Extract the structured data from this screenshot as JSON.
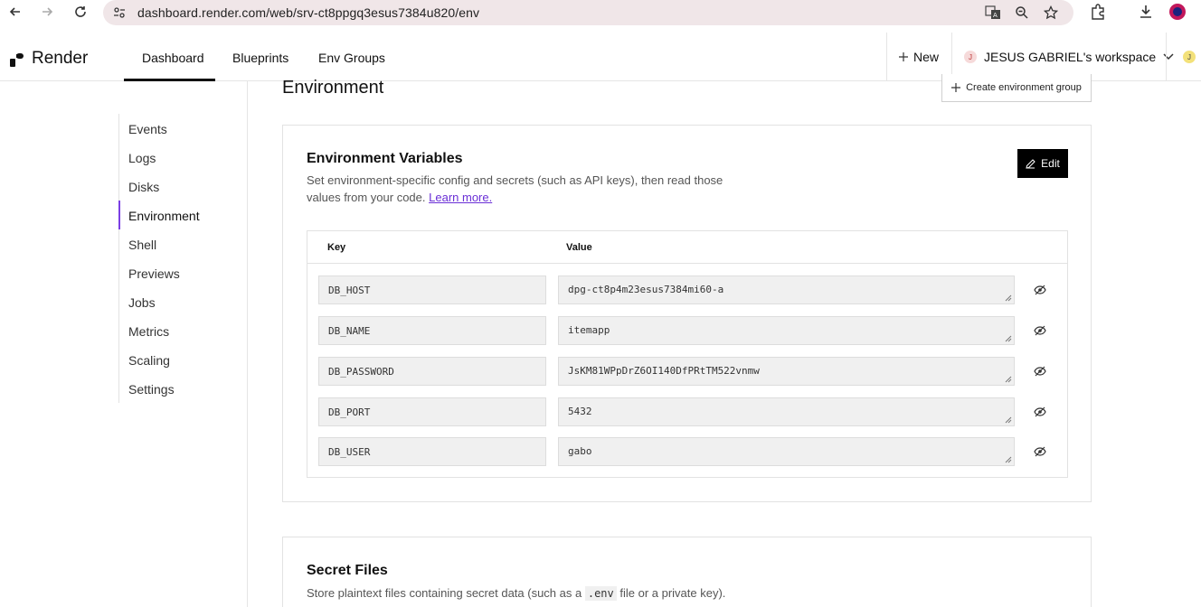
{
  "browser": {
    "url": "dashboard.render.com/web/srv-ct8ppgq3esus7384u820/env"
  },
  "header": {
    "logo_text": "Render",
    "tabs": [
      {
        "label": "Dashboard",
        "active": true
      },
      {
        "label": "Blueprints",
        "active": false
      },
      {
        "label": "Env Groups",
        "active": false
      }
    ],
    "new_label": "New",
    "workspace_initial": "J",
    "workspace_label": "JESUS GABRIEL's workspace",
    "user_initial": "J"
  },
  "sidebar": {
    "items": [
      {
        "label": "Events"
      },
      {
        "label": "Logs"
      },
      {
        "label": "Disks"
      },
      {
        "label": "Environment",
        "active": true
      },
      {
        "label": "Shell"
      },
      {
        "label": "Previews"
      },
      {
        "label": "Jobs"
      },
      {
        "label": "Metrics"
      },
      {
        "label": "Scaling"
      },
      {
        "label": "Settings"
      }
    ]
  },
  "main": {
    "page_title": "Environment",
    "create_group_label": "Create environment group",
    "env_vars": {
      "title": "Environment Variables",
      "desc_line1": "Set environment-specific config and secrets (such as API keys), then read those",
      "desc_line2_prefix": "values from your code. ",
      "learn_more": "Learn more.",
      "edit_label": "Edit",
      "col_key": "Key",
      "col_value": "Value",
      "rows": [
        {
          "key": "DB_HOST",
          "value": "dpg-ct8p4m23esus7384mi60-a"
        },
        {
          "key": "DB_NAME",
          "value": "itemapp"
        },
        {
          "key": "DB_PASSWORD",
          "value": "JsKM81WPpDrZ6OI140DfPRtTM522vnmw"
        },
        {
          "key": "DB_PORT",
          "value": "5432"
        },
        {
          "key": "DB_USER",
          "value": "gabo"
        }
      ]
    },
    "secret_files": {
      "title": "Secret Files",
      "desc_prefix": "Store plaintext files containing secret data (such as a ",
      "desc_code": ".env",
      "desc_suffix": " file or a private key)."
    }
  },
  "colors": {
    "accent": "#7b3fe4",
    "url_bar": "#f0e6e8",
    "edit_button": "#000000"
  }
}
